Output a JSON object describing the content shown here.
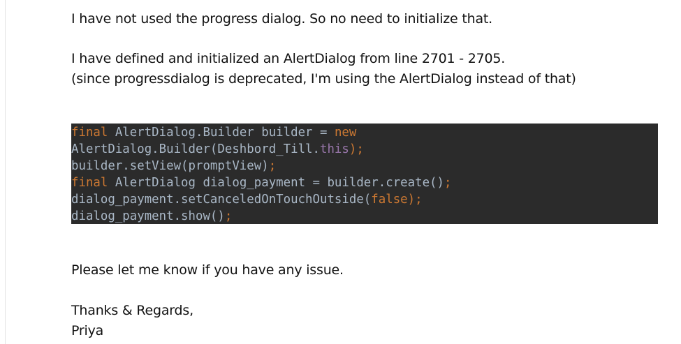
{
  "email": {
    "para1": "I have not used the progress dialog. So no need to initialize that.",
    "para2_line1": "I have defined and initialized  an AlertDialog from line 2701 - 2705.",
    "para2_line2": "(since progressdialog is deprecated, I'm using the AlertDialog instead of that)",
    "code_lines": [
      {
        "t1": "final",
        "t2": " AlertDialog.Builder builder = ",
        "t3": "new"
      },
      {
        "t1": "AlertDialog.Builder(Deshbord_Till.",
        "t2": "this",
        "t3": ");"
      },
      {
        "t1": "builder.setView(promptView)",
        "t2": ";"
      },
      {
        "t1": "final",
        "t2": " AlertDialog dialog_payment = builder.create()",
        "t3": ";"
      },
      {
        "t1": "dialog_payment.setCanceledOnTouchOutside(",
        "t2": "false",
        "t3": ");"
      },
      {
        "t1": "dialog_payment.show()",
        "t2": ";"
      }
    ],
    "para3": "Please let me know if you have any issue.",
    "closing": "Thanks & Regards,",
    "signature": "Priya"
  },
  "colors": {
    "code_background": "#2b2b2b",
    "code_keyword": "#cc7832",
    "code_text": "#a9b7c6"
  }
}
